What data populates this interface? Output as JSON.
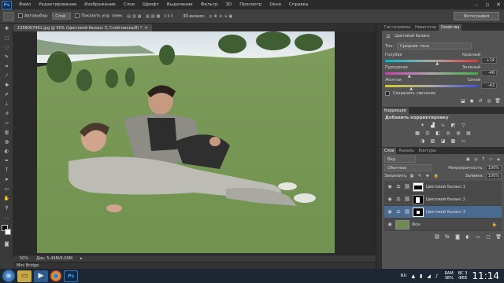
{
  "menu": {
    "logo": "Ps",
    "items": [
      "Файл",
      "Редактирование",
      "Изображение",
      "Слои",
      "Шрифт",
      "Выделение",
      "Фильтр",
      "3D",
      "Просмотр",
      "Окно",
      "Справка"
    ]
  },
  "options": {
    "autoselect_label": "Автовыбор:",
    "autoselect_value": "Слой",
    "show_controls_label": "Показать упр. элем.",
    "threed_label": "3D-режим:",
    "workspace": "Фотография"
  },
  "document": {
    "tab_title": "1356007461.jpg @ 50% (Цветовой баланс 3, Слой-маска/8) *",
    "zoom": "50%",
    "doc_size": "Док: 5,49М/9,09М",
    "mini_bridge": "Mini Bridge"
  },
  "panels": {
    "top_tabs": [
      "Гистограмма",
      "Навигатор",
      "Свойства"
    ],
    "properties_title": "Цветовой баланс",
    "tone_label": "Тон:",
    "tone_value": "Средние тона",
    "sliders": [
      {
        "left": "Голубая",
        "right": "Красный",
        "value": "+14",
        "color_left": "#00b7c7",
        "color_right": "#d9383a",
        "position": 0.57
      },
      {
        "left": "Пурпурная",
        "right": "Зеленый",
        "value": "-46",
        "color_left": "#c63fb0",
        "color_right": "#3fae3f",
        "position": 0.27
      },
      {
        "left": "Желтая",
        "right": "Синий",
        "value": "-42",
        "color_left": "#d9c72e",
        "color_right": "#3c4fd4",
        "position": 0.29
      }
    ],
    "preserve_luminosity": "Сохранить свечение",
    "correction_tab": "Коррекция",
    "correction_title": "Добавить корректировку",
    "layers_tabs": [
      "Слои",
      "Каналы",
      "Контуры"
    ],
    "kind_label": "Вид",
    "blend_mode": "Обычные",
    "opacity_label": "Непрозрачность:",
    "opacity_value": "100%",
    "lock_label": "Закрепить:",
    "fill_label": "Заливка:",
    "fill_value": "100%",
    "layers": [
      {
        "name": "Цветовой баланс 1",
        "selected": false
      },
      {
        "name": "Цветовой баланс 2",
        "selected": false
      },
      {
        "name": "Цветовой баланс 3",
        "selected": true
      },
      {
        "name": "Фон",
        "selected": false
      }
    ]
  },
  "taskbar": {
    "lang": "RU",
    "ram_label": "RAM",
    "ram_value": "38%",
    "date_day": "ВС 3",
    "date_month": "ФЕВ",
    "time": "11:14"
  }
}
